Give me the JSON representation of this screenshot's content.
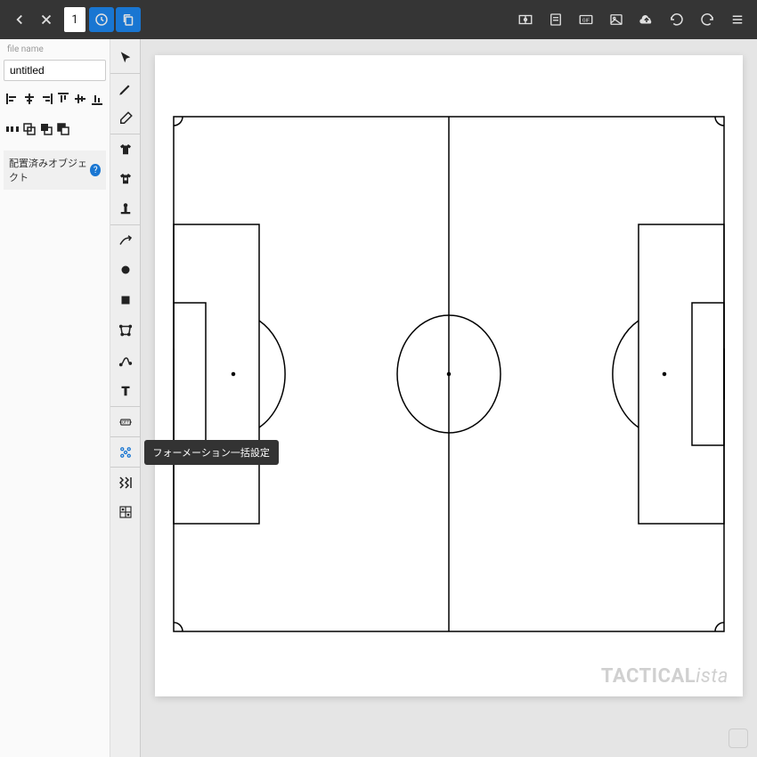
{
  "topbar": {
    "page_number": "1"
  },
  "side_panel": {
    "file_name_label": "file name",
    "file_name_value": "untitled",
    "placed_objects_label": "配置済みオブジェクト",
    "help_char": "?"
  },
  "tooltip": {
    "formation_batch": "フォーメーション一括設定"
  },
  "watermark": {
    "strong": "TACTICAL",
    "italic": "ista"
  }
}
